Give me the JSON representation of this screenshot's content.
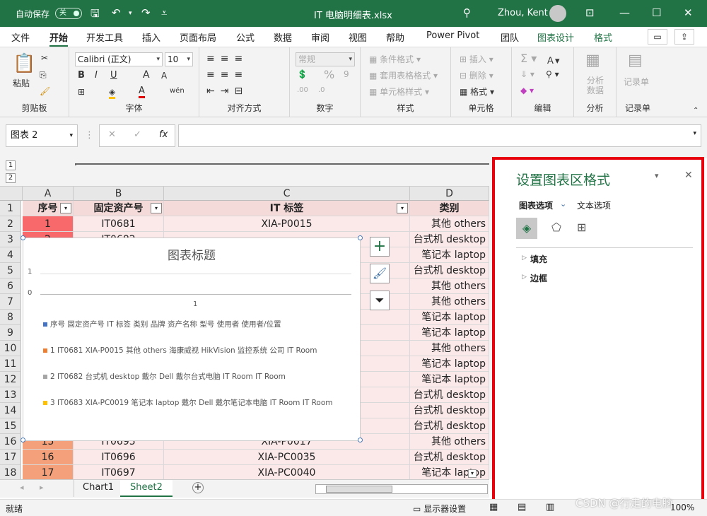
{
  "titlebar": {
    "autosave": "自动保存",
    "autosave_state": "关",
    "filename": "IT 电脑明细表.xlsx",
    "user": "Zhou, Kent"
  },
  "menu": {
    "tabs": [
      "文件",
      "开始",
      "开发工具",
      "插入",
      "页面布局",
      "公式",
      "数据",
      "审阅",
      "视图",
      "帮助",
      "Power Pivot",
      "团队",
      "图表设计",
      "格式"
    ]
  },
  "ribbon": {
    "clipboard": {
      "paste": "粘贴",
      "label": "剪贴板"
    },
    "font": {
      "name": "Calibri (正文)",
      "size": "10",
      "bold": "B",
      "italic": "I",
      "underline": "U",
      "grow": "A",
      "shrink": "A",
      "label": "字体"
    },
    "align": {
      "label": "对齐方式"
    },
    "number": {
      "format": "常规",
      "percent": "%",
      "comma": "9",
      "label": "数字"
    },
    "styles": {
      "cond": "条件格式",
      "table": "套用表格格式",
      "cell": "单元格样式",
      "label": "样式"
    },
    "cells": {
      "insert": "插入",
      "delete": "删除",
      "format": "格式",
      "label": "单元格"
    },
    "edit": {
      "label": "编辑"
    },
    "analyze": {
      "btn": "分析数据",
      "label": "分析"
    },
    "record": {
      "btn": "记录单",
      "label": "记录单"
    }
  },
  "formula": {
    "namebox": "图表 2",
    "fx": "fx"
  },
  "grid": {
    "outline": [
      "1",
      "2"
    ],
    "cols": [
      "A",
      "B",
      "C",
      "D"
    ],
    "header": [
      "序号",
      "固定资产号",
      "IT 标签",
      "类别"
    ],
    "rows": [
      [
        "1",
        "IT0681",
        "XIA-P0015",
        "其他 others"
      ],
      [
        "2",
        "IT0682",
        "",
        "台式机 desktop"
      ],
      [
        "",
        "",
        "",
        "笔记本 laptop"
      ],
      [
        "",
        "",
        "",
        "台式机 desktop"
      ],
      [
        "",
        "",
        "",
        "其他 others"
      ],
      [
        "",
        "",
        "",
        "其他 others"
      ],
      [
        "",
        "",
        "",
        "笔记本 laptop"
      ],
      [
        "",
        "",
        "",
        "笔记本 laptop"
      ],
      [
        "",
        "",
        "",
        "其他 others"
      ],
      [
        "",
        "",
        "",
        "笔记本 laptop"
      ],
      [
        "",
        "",
        "",
        "笔记本 laptop"
      ],
      [
        "",
        "",
        "",
        "台式机 desktop"
      ],
      [
        "",
        "",
        "",
        "台式机 desktop"
      ],
      [
        "",
        "",
        "",
        "台式机 desktop"
      ],
      [
        "15",
        "IT0695",
        "XIA-P0017",
        "其他 others"
      ],
      [
        "16",
        "IT0696",
        "XIA-PC0035",
        "台式机 desktop"
      ],
      [
        "17",
        "IT0697",
        "XIA-PC0040",
        "笔记本 laptop"
      ]
    ],
    "rownums": [
      "1",
      "2",
      "3",
      "4",
      "5",
      "6",
      "7",
      "8",
      "9",
      "10",
      "11",
      "12",
      "13",
      "14",
      "15",
      "16",
      "17",
      "18"
    ]
  },
  "chart": {
    "title": "图表标题",
    "yticks": [
      "1",
      "0"
    ],
    "xtick": "1",
    "legend": [
      {
        "text": "序号 固定资产号 IT 标签 类别 品牌 资产名称 型号 使用者 使用者/位置",
        "color": "#4472c4"
      },
      {
        "text": "1 IT0681 XIA-P0015 其他 others 海康威视 HikVision 监控系统 公司 IT Room",
        "color": "#ed7d31"
      },
      {
        "text": "2 IT0682 台式机 desktop 戴尔 Dell 戴尔台式电脑 IT Room IT Room",
        "color": "#a5a5a5"
      },
      {
        "text": "3 IT0683 XIA-PC0019 笔记本 laptop 戴尔 Dell 戴尔笔记本电脑 IT Room IT Room",
        "color": "#ffc000"
      }
    ]
  },
  "pane": {
    "title": "设置图表区格式",
    "tab1": "图表选项",
    "tab2": "文本选项",
    "sec1": "填充",
    "sec2": "边框"
  },
  "sheets": {
    "tabs": [
      "Chart1",
      "Sheet2"
    ]
  },
  "status": {
    "ready": "就绪",
    "display": "显示器设置",
    "zoom": "100%",
    "watermark": "CSDN @行走的电脑"
  }
}
